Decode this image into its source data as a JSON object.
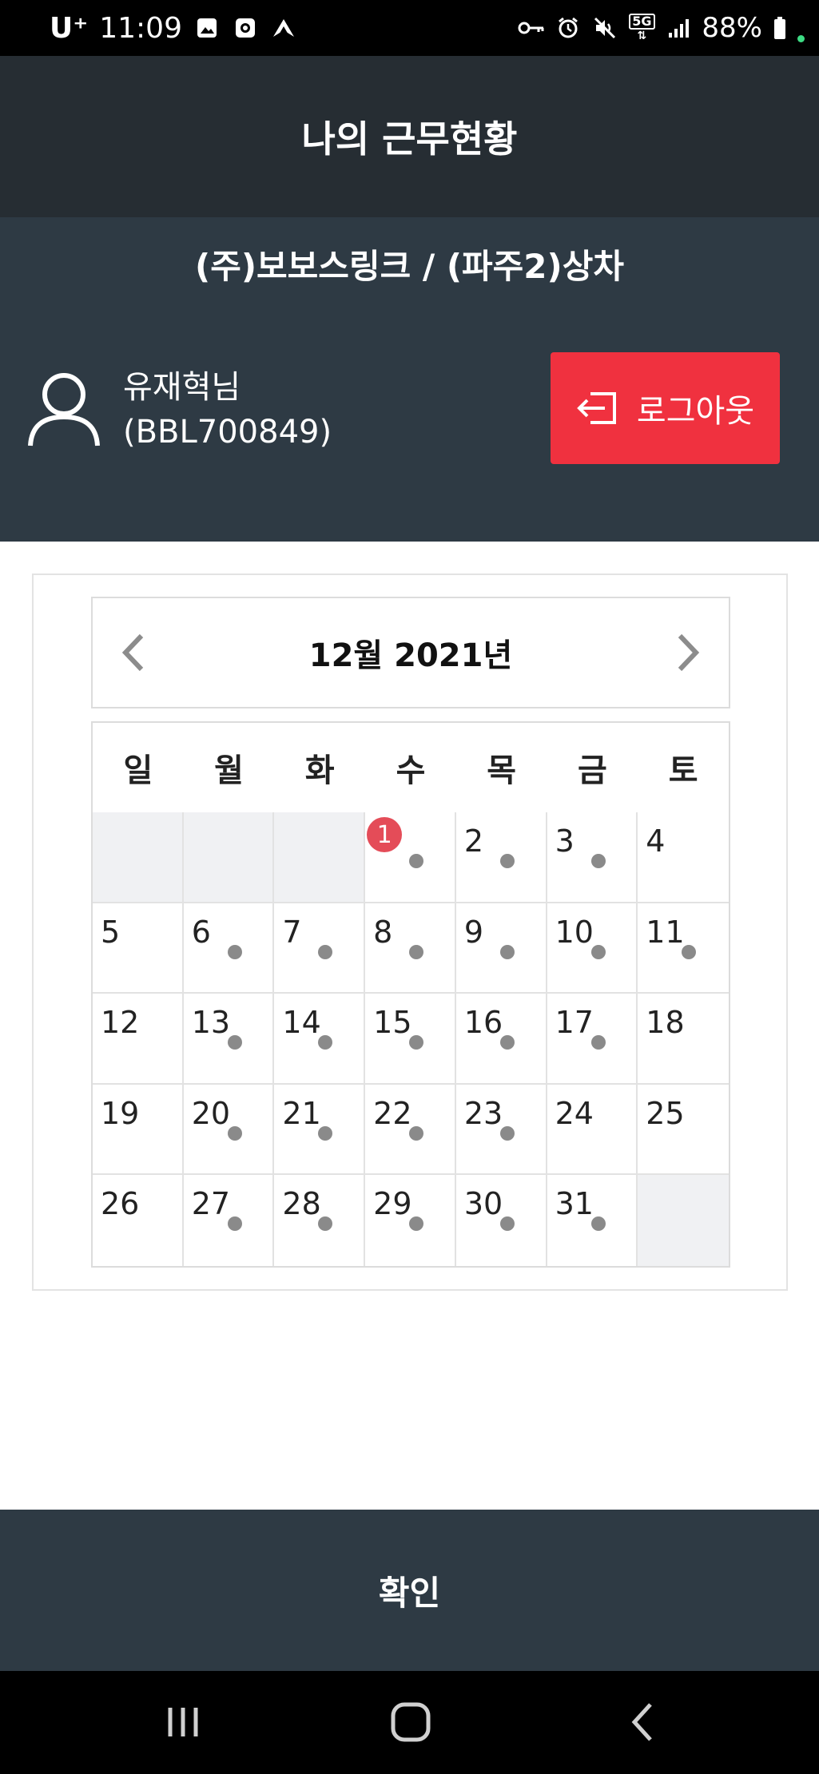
{
  "status_bar": {
    "carrier": "U⁺",
    "time": "11:09",
    "battery": "88%",
    "network": "5G",
    "left_icons": [
      "image-icon",
      "screen-record-icon",
      "navigation-icon"
    ],
    "right_icons": [
      "key-icon",
      "alarm-icon",
      "mute-icon",
      "5g-icon",
      "signal-icon",
      "battery-icon"
    ]
  },
  "header": {
    "title": "나의 근무현황"
  },
  "user": {
    "company": "(주)보보스링크 / (파주2)상차",
    "name": "유재혁님",
    "id": "(BBL700849)",
    "logout_label": "로그아웃",
    "avatar_icon": "user-icon"
  },
  "calendar": {
    "month_title": "12월 2021년",
    "weekdays": [
      "일",
      "월",
      "화",
      "수",
      "목",
      "금",
      "토"
    ],
    "leading_empty": 3,
    "trailing_empty": 1,
    "days": [
      {
        "n": "1",
        "dot": true,
        "badge": "1"
      },
      {
        "n": "2",
        "dot": true
      },
      {
        "n": "3",
        "dot": true
      },
      {
        "n": "4",
        "dot": false
      },
      {
        "n": "5",
        "dot": false
      },
      {
        "n": "6",
        "dot": true
      },
      {
        "n": "7",
        "dot": true
      },
      {
        "n": "8",
        "dot": true
      },
      {
        "n": "9",
        "dot": true
      },
      {
        "n": "10",
        "dot": true
      },
      {
        "n": "11",
        "dot": true
      },
      {
        "n": "12",
        "dot": false
      },
      {
        "n": "13",
        "dot": true
      },
      {
        "n": "14",
        "dot": true
      },
      {
        "n": "15",
        "dot": true
      },
      {
        "n": "16",
        "dot": true
      },
      {
        "n": "17",
        "dot": true
      },
      {
        "n": "18",
        "dot": false
      },
      {
        "n": "19",
        "dot": false
      },
      {
        "n": "20",
        "dot": true
      },
      {
        "n": "21",
        "dot": true
      },
      {
        "n": "22",
        "dot": true
      },
      {
        "n": "23",
        "dot": true
      },
      {
        "n": "24",
        "dot": false
      },
      {
        "n": "25",
        "dot": false
      },
      {
        "n": "26",
        "dot": false
      },
      {
        "n": "27",
        "dot": true
      },
      {
        "n": "28",
        "dot": true
      },
      {
        "n": "29",
        "dot": true
      },
      {
        "n": "30",
        "dot": true
      },
      {
        "n": "31",
        "dot": true
      }
    ]
  },
  "footer": {
    "confirm_label": "확인"
  },
  "colors": {
    "header_bg": "#262d33",
    "section_bg": "#2e3a44",
    "logout_red": "#f0313f",
    "badge_red": "#e44c58",
    "dot_gray": "#8a8a8a",
    "empty_cell": "#f0f1f3"
  },
  "nav_icons": [
    "recent-apps-icon",
    "home-icon",
    "back-icon"
  ]
}
